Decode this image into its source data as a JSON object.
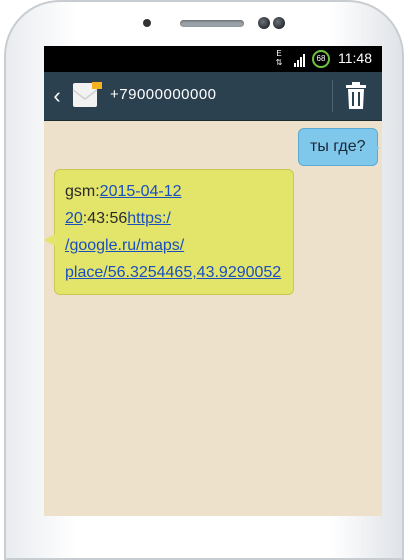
{
  "status_bar": {
    "network_type": "E",
    "battery_level": "68",
    "time": "11:48"
  },
  "header": {
    "back_icon": "chevron-left-icon",
    "contact_icon": "envelope-icon",
    "contact_number": "+79000000000",
    "delete_icon": "trash-icon"
  },
  "messages": {
    "outgoing": {
      "text": "ты где?"
    },
    "incoming": {
      "prefix": "gsm:",
      "date_link": "2015-04-12 20",
      "time_rest": ":43:56",
      "url_part1": "https:/",
      "url_part2": "/google.ru/maps/",
      "url_part3": "place/56.3254465,43.9290052"
    }
  },
  "colors": {
    "header_bg": "#2b4150",
    "screen_bg": "#eee1cc",
    "outgoing_bubble": "#7fc8ec",
    "incoming_bubble": "#e3e46a",
    "link": "#1a4fbf"
  }
}
